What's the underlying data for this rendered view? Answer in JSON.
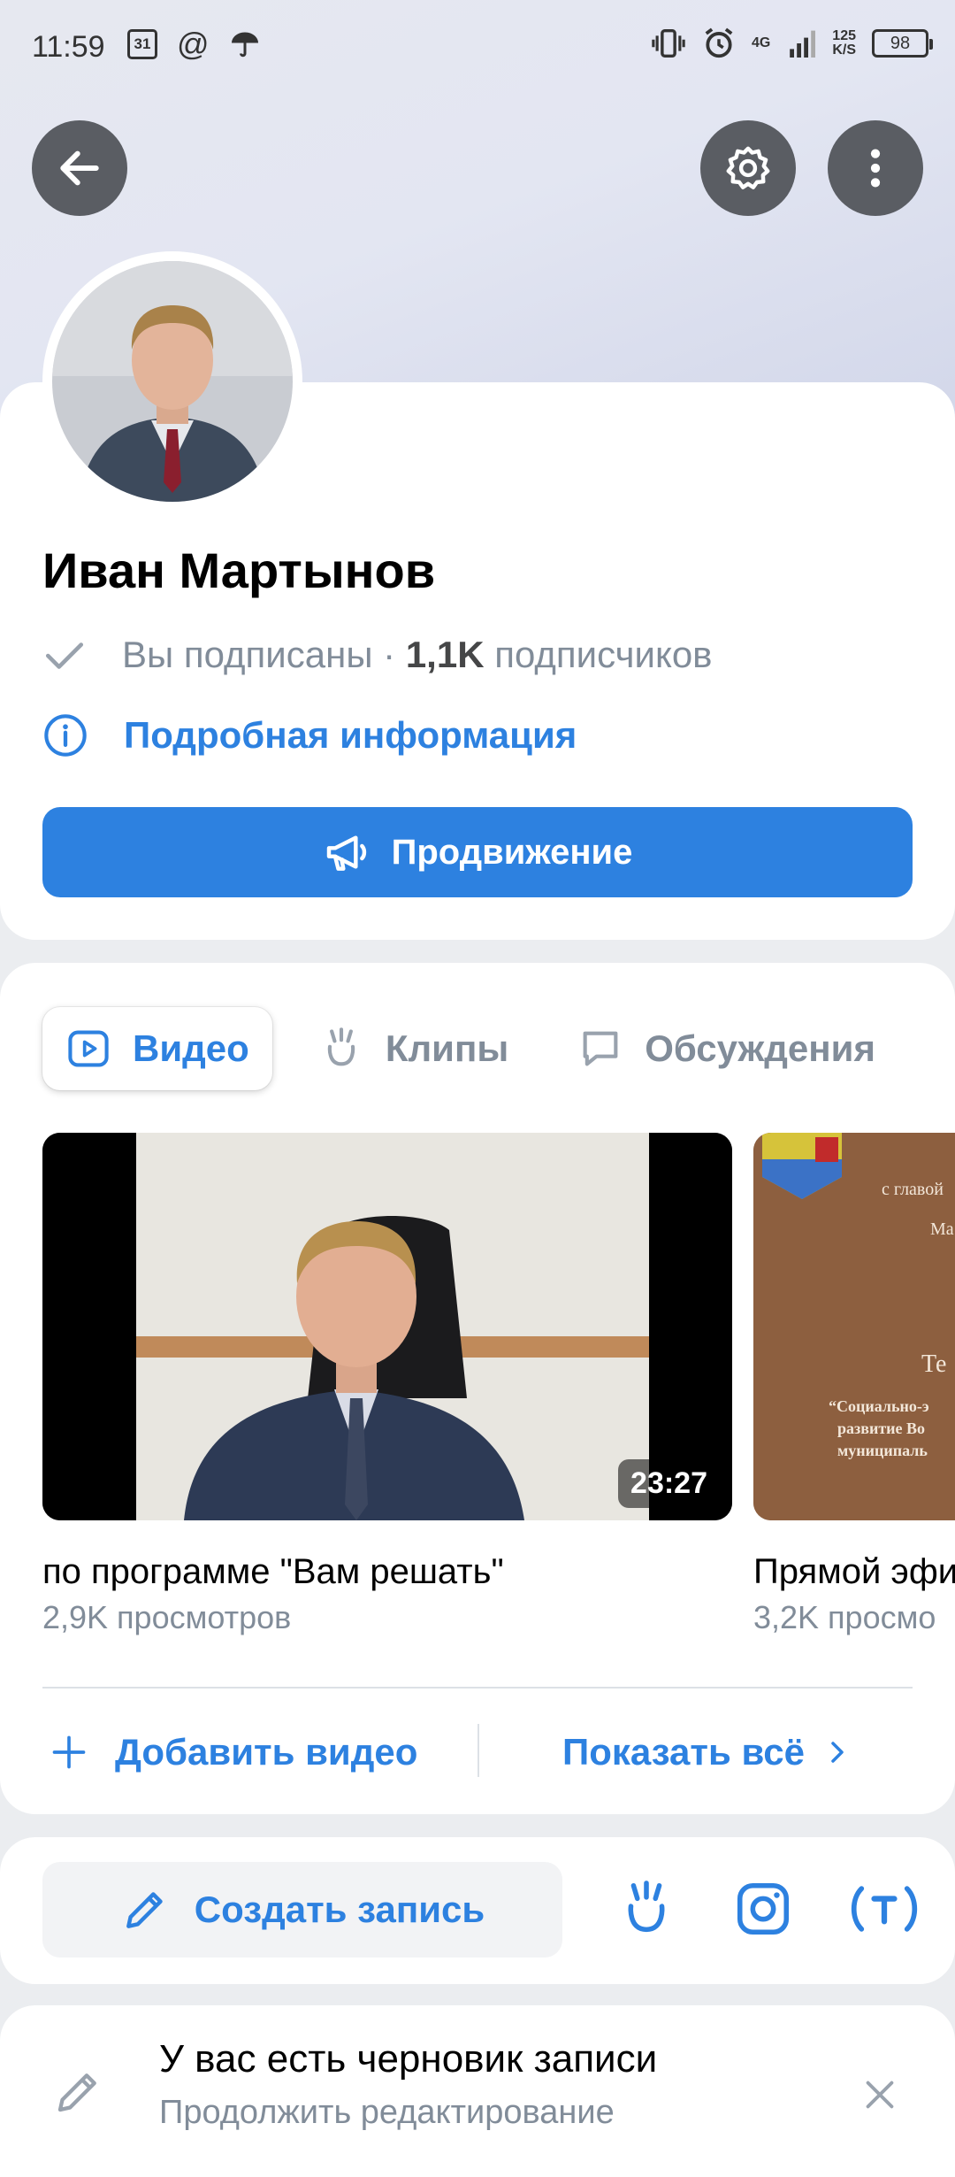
{
  "status_bar": {
    "time": "11:59",
    "calendar_day": "31",
    "network": "4G",
    "speed_value": "125",
    "speed_unit": "K/S",
    "battery": "98"
  },
  "profile": {
    "name": "Иван Мартынов",
    "subscribed_label": "Вы подписаны",
    "subscribers_count": "1,1K",
    "subscribers_label": "подписчиков",
    "info_link": "Подробная информация",
    "promo_button": "Продвижение"
  },
  "tabs": [
    {
      "label": "Видео",
      "icon": "video-icon",
      "active": true
    },
    {
      "label": "Клипы",
      "icon": "clips-icon",
      "active": false
    },
    {
      "label": "Обсуждения",
      "icon": "discussions-icon",
      "active": false
    }
  ],
  "videos": [
    {
      "title": "по программе \"Вам решать\"",
      "views": "2,9K просмотров",
      "duration": "23:27"
    },
    {
      "title": "Прямой эфи",
      "views": "3,2K просмо",
      "slide_lines": [
        "с главой",
        "Ма",
        "Те",
        "“Социально-э",
        "развитие Во",
        "муниципаль"
      ]
    }
  ],
  "actions": {
    "add_video": "Добавить видео",
    "show_all": "Показать всё"
  },
  "post": {
    "create_post": "Создать запись"
  },
  "draft": {
    "title": "У вас есть черновик записи",
    "subtitle": "Продолжить редактирование"
  },
  "colors": {
    "accent": "#2d81e0",
    "secondary_text": "#818c99",
    "background": "#ebedf0"
  }
}
